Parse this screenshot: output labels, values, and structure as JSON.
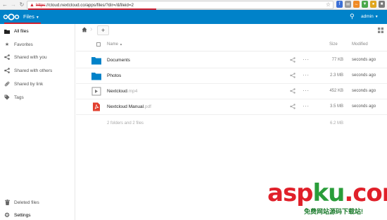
{
  "browser": {
    "url_scheme": "https",
    "url_rest": "://cloud.nextcloud.co/apps/files/?dir=/&fileid=2"
  },
  "header": {
    "app_name": "Files",
    "user": "admin",
    "brand_color": "#0082c9"
  },
  "sidebar": {
    "items": [
      {
        "label": "All files",
        "icon": "folder-icon"
      },
      {
        "label": "Favorites",
        "icon": "star-icon"
      },
      {
        "label": "Shared with you",
        "icon": "share-icon"
      },
      {
        "label": "Shared with others",
        "icon": "share-icon"
      },
      {
        "label": "Shared by link",
        "icon": "link-icon"
      },
      {
        "label": "Tags",
        "icon": "tag-icon"
      }
    ],
    "bottom": [
      {
        "label": "Deleted files",
        "icon": "trash-icon"
      },
      {
        "label": "Settings",
        "icon": "gear-icon"
      }
    ]
  },
  "table": {
    "columns": {
      "name": "Name",
      "size": "Size",
      "modified": "Modified"
    },
    "rows": [
      {
        "name": "Documents",
        "ext": "",
        "type": "folder",
        "size": "77 KB",
        "modified": "seconds ago"
      },
      {
        "name": "Photos",
        "ext": "",
        "type": "folder",
        "size": "2.3 MB",
        "modified": "seconds ago"
      },
      {
        "name": "Nextcloud",
        "ext": ".mp4",
        "type": "video",
        "size": "452 KB",
        "modified": "seconds ago"
      },
      {
        "name": "Nextcloud Manual",
        "ext": ".pdf",
        "type": "pdf",
        "size": "3.5 MB",
        "modified": "seconds ago"
      }
    ],
    "summary": "2 folders and 2 files",
    "total_size": "6.2 MB"
  },
  "watermark": {
    "big_a": "asp",
    "big_b": "ku",
    "big_c": ".com",
    "small": "免费网站源码下载站!"
  }
}
